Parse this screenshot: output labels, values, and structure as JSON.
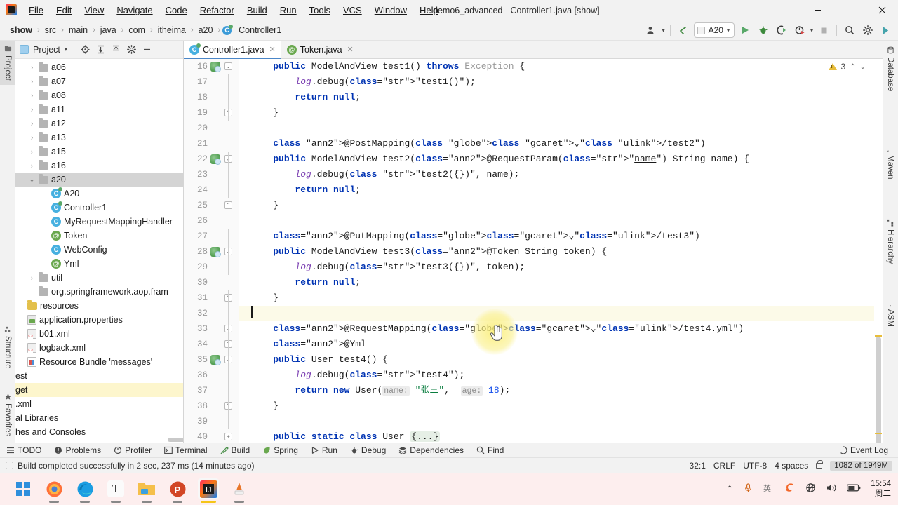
{
  "window": {
    "title": "demo6_advanced - Controller1.java [show]",
    "minimize": "—",
    "maximize": "▢",
    "close": "✕"
  },
  "menu": {
    "items": [
      "File",
      "Edit",
      "View",
      "Navigate",
      "Code",
      "Refactor",
      "Build",
      "Run",
      "Tools",
      "VCS",
      "Window",
      "Help"
    ]
  },
  "breadcrumbs": {
    "items": [
      "show",
      "src",
      "main",
      "java",
      "com",
      "itheima",
      "a20"
    ],
    "separator": "›",
    "file": "Controller1",
    "file_icon_letter": "C"
  },
  "toolbar": {
    "vcs_icon": "vcs-user-icon",
    "back_icon": "back-arrow-icon",
    "run_config": "A20",
    "run_icon": "▶",
    "debug_icon": "debug-bug-icon",
    "run_coverage_icon": "run-coverage-icon",
    "profiler_icon": "profiler-icon",
    "stop_icon": "■",
    "search_icon": "⌕",
    "settings_icon": "⚙",
    "services_icon": "ide-services-icon",
    "caret": "▾"
  },
  "left_tool_strip": {
    "tabs": [
      "Project",
      "Structure",
      "Favorites"
    ],
    "active": "Project"
  },
  "right_tool_strip": {
    "tabs": [
      "Database",
      "Maven",
      "Hierarchy",
      "ASM"
    ]
  },
  "project_panel": {
    "title": "Project",
    "title_caret": "▾",
    "icons": [
      "locate-icon",
      "expand-all-icon",
      "collapse-all-icon",
      "settings-icon",
      "hide-icon"
    ],
    "tree": [
      {
        "label": "a06",
        "type": "folder",
        "indent": 1,
        "arrow": "›"
      },
      {
        "label": "a07",
        "type": "folder",
        "indent": 1,
        "arrow": "›"
      },
      {
        "label": "a08",
        "type": "folder",
        "indent": 1,
        "arrow": "›"
      },
      {
        "label": "a11",
        "type": "folder",
        "indent": 1,
        "arrow": "›"
      },
      {
        "label": "a12",
        "type": "folder",
        "indent": 1,
        "arrow": "›"
      },
      {
        "label": "a13",
        "type": "folder",
        "indent": 1,
        "arrow": "›"
      },
      {
        "label": "a15",
        "type": "folder",
        "indent": 1,
        "arrow": "›"
      },
      {
        "label": "a16",
        "type": "folder",
        "indent": 1,
        "arrow": "›"
      },
      {
        "label": "a20",
        "type": "folder",
        "indent": 1,
        "arrow": "⌄",
        "selected": true
      },
      {
        "label": "A20",
        "type": "class-run",
        "indent": 2,
        "arrow": ""
      },
      {
        "label": "Controller1",
        "type": "class-run",
        "indent": 2,
        "arrow": ""
      },
      {
        "label": "MyRequestMappingHandler",
        "type": "class",
        "indent": 2,
        "arrow": ""
      },
      {
        "label": "Token",
        "type": "annotation",
        "indent": 2,
        "arrow": ""
      },
      {
        "label": "WebConfig",
        "type": "class",
        "indent": 2,
        "arrow": ""
      },
      {
        "label": "Yml",
        "type": "annotation",
        "indent": 2,
        "arrow": ""
      },
      {
        "label": "util",
        "type": "folder",
        "indent": 1,
        "arrow": "›"
      },
      {
        "label": "org.springframework.aop.fram",
        "type": "folder",
        "indent": 1,
        "arrow": ""
      },
      {
        "label": "resources",
        "type": "resources",
        "indent": 0,
        "arrow": ""
      },
      {
        "label": "application.properties",
        "type": "properties",
        "indent": 0,
        "arrow": ""
      },
      {
        "label": "b01.xml",
        "type": "xml",
        "indent": 0,
        "arrow": ""
      },
      {
        "label": "logback.xml",
        "type": "xml",
        "indent": 0,
        "arrow": ""
      },
      {
        "label": "Resource Bundle 'messages'",
        "type": "bundle",
        "indent": 0,
        "arrow": ""
      },
      {
        "label": "est",
        "type": "cut",
        "indent": 0,
        "arrow": ""
      },
      {
        "label": "get",
        "type": "cut",
        "indent": 0,
        "arrow": "",
        "highlighted": true
      },
      {
        "label": ".xml",
        "type": "cut",
        "indent": 0,
        "arrow": ""
      },
      {
        "label": "al Libraries",
        "type": "cut",
        "indent": 0,
        "arrow": ""
      },
      {
        "label": "hes and Consoles",
        "type": "cut",
        "indent": 0,
        "arrow": ""
      }
    ]
  },
  "editor": {
    "tabs": [
      {
        "label": "Controller1.java",
        "icon": "class-run-icon",
        "active": true,
        "close": "✕"
      },
      {
        "label": "Token.java",
        "icon": "annotation-icon",
        "active": false,
        "close": "✕"
      }
    ],
    "inspection": {
      "warning_icon": "warning-triangle-icon",
      "count": "3",
      "prev": "⌃",
      "next": "⌄"
    },
    "caret_position": "32:1",
    "lines": [
      {
        "num": "16",
        "gutter": "spring",
        "fold": "collapse",
        "text": "    public ModelAndView test1() throws Exception {"
      },
      {
        "num": "17",
        "gutter": "",
        "fold": "",
        "text": "        log.debug(\"test1()\");"
      },
      {
        "num": "18",
        "gutter": "",
        "fold": "",
        "text": "        return null;"
      },
      {
        "num": "19",
        "gutter": "",
        "fold": "end",
        "text": "    }"
      },
      {
        "num": "20",
        "gutter": "",
        "fold": "",
        "text": ""
      },
      {
        "num": "21",
        "gutter": "",
        "fold": "",
        "text": "    @PostMapping(\"/test2\")"
      },
      {
        "num": "22",
        "gutter": "spring",
        "fold": "collapse",
        "text": "    public ModelAndView test2(@RequestParam(\"name\") String name) {"
      },
      {
        "num": "23",
        "gutter": "",
        "fold": "",
        "text": "        log.debug(\"test2({})\", name);"
      },
      {
        "num": "24",
        "gutter": "",
        "fold": "",
        "text": "        return null;"
      },
      {
        "num": "25",
        "gutter": "",
        "fold": "end",
        "text": "    }"
      },
      {
        "num": "26",
        "gutter": "",
        "fold": "",
        "text": ""
      },
      {
        "num": "27",
        "gutter": "",
        "fold": "",
        "text": "    @PutMapping(\"/test3\")"
      },
      {
        "num": "28",
        "gutter": "spring",
        "fold": "collapse",
        "text": "    public ModelAndView test3(@Token String token) {"
      },
      {
        "num": "29",
        "gutter": "",
        "fold": "",
        "text": "        log.debug(\"test3({})\", token);"
      },
      {
        "num": "30",
        "gutter": "",
        "fold": "",
        "text": "        return null;"
      },
      {
        "num": "31",
        "gutter": "",
        "fold": "end",
        "text": "    }"
      },
      {
        "num": "32",
        "gutter": "",
        "fold": "",
        "text": "",
        "current": true
      },
      {
        "num": "33",
        "gutter": "",
        "fold": "collapse",
        "text": "    @RequestMapping(\"/test4.yml\")"
      },
      {
        "num": "34",
        "gutter": "",
        "fold": "end",
        "text": "    @Yml"
      },
      {
        "num": "35",
        "gutter": "spring",
        "fold": "collapse",
        "text": "    public User test4() {"
      },
      {
        "num": "36",
        "gutter": "",
        "fold": "",
        "text": "        log.debug(\"test4\");"
      },
      {
        "num": "37",
        "gutter": "",
        "fold": "",
        "text": "        return new User( name: \"张三\",  age: 18);"
      },
      {
        "num": "38",
        "gutter": "",
        "fold": "end",
        "text": "    }"
      },
      {
        "num": "39",
        "gutter": "",
        "fold": "",
        "text": ""
      },
      {
        "num": "40",
        "gutter": "",
        "fold": "expand",
        "text": "    public static class User {...}"
      }
    ]
  },
  "tool_windows": {
    "items": [
      {
        "label": "TODO",
        "icon": "todo-icon"
      },
      {
        "label": "Problems",
        "icon": "problems-icon"
      },
      {
        "label": "Profiler",
        "icon": "profiler-icon"
      },
      {
        "label": "Terminal",
        "icon": "terminal-icon"
      },
      {
        "label": "Build",
        "icon": "build-hammer-icon"
      },
      {
        "label": "Spring",
        "icon": "spring-leaf-icon"
      },
      {
        "label": "Run",
        "icon": "run-icon"
      },
      {
        "label": "Debug",
        "icon": "debug-icon"
      },
      {
        "label": "Dependencies",
        "icon": "dependencies-icon"
      },
      {
        "label": "Find",
        "icon": "find-icon"
      }
    ],
    "event_log": {
      "label": "Event Log",
      "icon": "event-log-icon"
    }
  },
  "status_bar": {
    "message": "Build completed successfully in 2 sec, 237 ms (14 minutes ago)",
    "message_icon": "build-status-icon",
    "position": "32:1",
    "line_separator": "CRLF",
    "encoding": "UTF-8",
    "indent": "4 spaces",
    "lock_icon": "lock-icon",
    "memory": "1082 of 1949M"
  },
  "taskbar": {
    "apps": [
      {
        "name": "start-windows-icon"
      },
      {
        "name": "firefox-icon"
      },
      {
        "name": "edge-icon"
      },
      {
        "name": "typora-icon",
        "letter": "T"
      },
      {
        "name": "file-explorer-icon"
      },
      {
        "name": "powerpoint-icon",
        "letter": "P"
      },
      {
        "name": "intellij-idea-icon",
        "active": true
      },
      {
        "name": "vlc-icon"
      }
    ],
    "tray": {
      "chevron": "⌃",
      "mic_icon": "microphone-icon",
      "ime_icon": "ime-icon",
      "sogou_icon": "sogou-icon",
      "network_icon": "network-disconnected-icon",
      "volume_icon": "volume-icon",
      "battery_icon": "battery-icon"
    },
    "clock": {
      "time": "15:54",
      "day": "周二"
    }
  }
}
